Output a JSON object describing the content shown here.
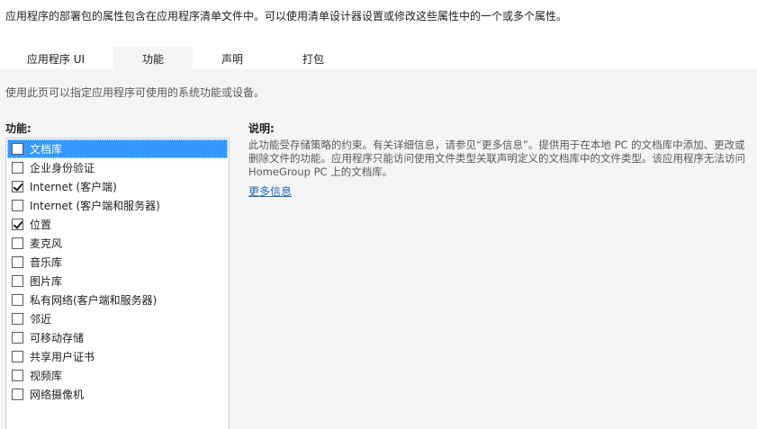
{
  "intro": "应用程序的部署包的属性包含在应用程序清单文件中。可以使用清单设计器设置或修改这些属性中的一个或多个属性。",
  "tabs": [
    {
      "label": "应用程序 UI",
      "active": false
    },
    {
      "label": "功能",
      "active": true
    },
    {
      "label": "声明",
      "active": false
    },
    {
      "label": "打包",
      "active": false
    }
  ],
  "panel": {
    "description": "使用此页可以指定应用程序可使用的系统功能或设备。"
  },
  "capabilities": {
    "heading": "功能:",
    "items": [
      {
        "label": "文档库",
        "checked": false,
        "selected": true
      },
      {
        "label": "企业身份验证",
        "checked": false,
        "selected": false
      },
      {
        "label": "Internet (客户端)",
        "checked": true,
        "selected": false
      },
      {
        "label": "Internet (客户端和服务器)",
        "checked": false,
        "selected": false
      },
      {
        "label": "位置",
        "checked": true,
        "selected": false
      },
      {
        "label": "麦克风",
        "checked": false,
        "selected": false
      },
      {
        "label": "音乐库",
        "checked": false,
        "selected": false
      },
      {
        "label": "图片库",
        "checked": false,
        "selected": false
      },
      {
        "label": "私有网络(客户端和服务器)",
        "checked": false,
        "selected": false
      },
      {
        "label": "邻近",
        "checked": false,
        "selected": false
      },
      {
        "label": "可移动存储",
        "checked": false,
        "selected": false
      },
      {
        "label": "共享用户证书",
        "checked": false,
        "selected": false
      },
      {
        "label": "视频库",
        "checked": false,
        "selected": false
      },
      {
        "label": "网络摄像机",
        "checked": false,
        "selected": false
      }
    ]
  },
  "details": {
    "heading": "说明:",
    "text": "此功能受存储策略的约束。有关详细信息，请参见“更多信息”。提供用于在本地 PC 的文档库中添加、更改或删除文件的功能。应用程序只能访问使用文件类型关联声明定义的文档库中的文件类型。该应用程序无法访问 HomeGroup PC 上的文档库。",
    "more_link": "更多信息"
  },
  "colors": {
    "selection": "#3399ff",
    "panel_bg": "#f5f5f5",
    "link": "#1e6bb8"
  }
}
